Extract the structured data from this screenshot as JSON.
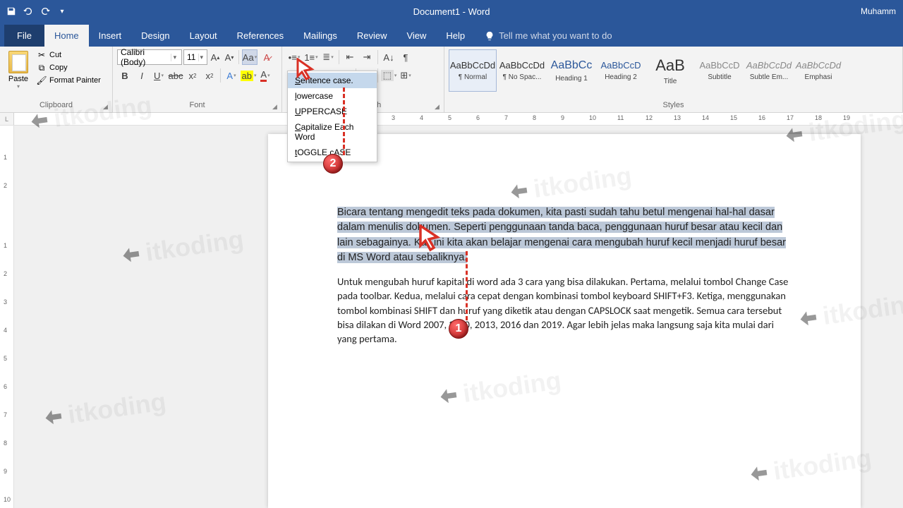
{
  "titlebar": {
    "document": "Document1  -  Word",
    "user": "Muhamm"
  },
  "tabs": [
    "File",
    "Home",
    "Insert",
    "Design",
    "Layout",
    "References",
    "Mailings",
    "Review",
    "View",
    "Help"
  ],
  "tell_me": "Tell me what you want to do",
  "clipboard": {
    "paste": "Paste",
    "cut": "Cut",
    "copy": "Copy",
    "format_painter": "Format Painter",
    "label": "Clipboard"
  },
  "font": {
    "name": "Calibri (Body)",
    "size": "11",
    "label": "Font"
  },
  "paragraph": {
    "label": "Paragraph"
  },
  "styles": {
    "label": "Styles",
    "items": [
      {
        "preview": "AaBbCcDd",
        "name": "¶ Normal",
        "cls": ""
      },
      {
        "preview": "AaBbCcDd",
        "name": "¶ No Spac...",
        "cls": ""
      },
      {
        "preview": "AaBbCc",
        "name": "Heading 1",
        "cls": "blue"
      },
      {
        "preview": "AaBbCcD",
        "name": "Heading 2",
        "cls": "blue"
      },
      {
        "preview": "AaB",
        "name": "Title",
        "cls": "big"
      },
      {
        "preview": "AaBbCcD",
        "name": "Subtitle",
        "cls": "gray"
      },
      {
        "preview": "AaBbCcDd",
        "name": "Subtle Em...",
        "cls": "italic"
      },
      {
        "preview": "AaBbCcDd",
        "name": "Emphasi",
        "cls": "italic"
      }
    ]
  },
  "case_menu": [
    "Sentence case.",
    "lowercase",
    "UPPERCASE",
    "Capitalize Each Word",
    "tOGGLE cASE"
  ],
  "ruler_corner": "L",
  "doc": {
    "p1": "Bicara tentang mengedit teks pada dokumen, kita pasti sudah tahu betul mengenai hal-hal dasar dalam menulis dokumen. Seperti penggunaan tanda baca, penggunaan huruf besar atau kecil dan lain sebagainya. Kali ini kita akan belajar mengenai cara mengubah huruf kecil menjadi huruf besar di MS Word atau sebaliknya.",
    "p2": "Untuk mengubah huruf kapital di word ada 3 cara yang bisa dilakukan. Pertama, melalui tombol Change Case pada toolbar. Kedua, melalui cara cepat dengan kombinasi tombol keyboard SHIFT+F3. Ketiga, menggunakan tombol kombinasi SHIFT dan huruf yang diketik atau dengan CAPSLOCK saat mengetik. Semua cara tersebut bisa dilakan di Word 2007, 2010, 2013, 2016 dan 2019. Agar lebih jelas maka langsung saja kita mulai dari yang pertama."
  },
  "watermark": "itkoding",
  "annotations": {
    "one": "1",
    "two": "2"
  }
}
